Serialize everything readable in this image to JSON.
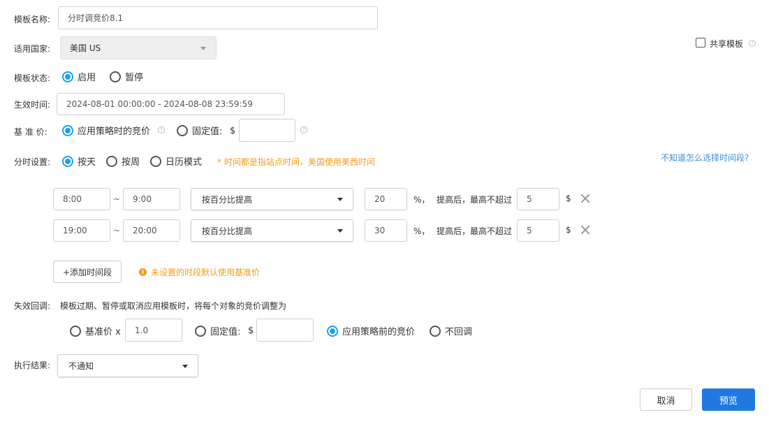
{
  "form": {
    "template_name": {
      "label": "模板名称:",
      "value": "分时调竞价8.1"
    },
    "country": {
      "label": "适用国家:",
      "value": "美国 US"
    },
    "share": {
      "label": "共享模板",
      "checked": false
    },
    "status": {
      "label": "模板状态:",
      "options": [
        {
          "label": "启用",
          "selected": true
        },
        {
          "label": "暂停",
          "selected": false
        }
      ]
    },
    "effective_time": {
      "label": "生效时间:",
      "value": "2024-08-01 00:00:00 - 2024-08-08 23:59:59"
    },
    "base_price": {
      "label": "基 准 价:",
      "options": [
        {
          "label": "应用策略时的竞价",
          "selected": true
        },
        {
          "label": "固定值:",
          "selected": false
        }
      ],
      "currency": "$",
      "fixed_value": ""
    },
    "time_setting": {
      "label": "分时设置:",
      "options": [
        {
          "label": "按天",
          "selected": true
        },
        {
          "label": "按周",
          "selected": false
        },
        {
          "label": "日历模式",
          "selected": false
        }
      ],
      "note": "* 时间都是指站点时间，美国使用美西时间",
      "help_link": "不知道怎么选择时间段?"
    },
    "periods": [
      {
        "start": "8:00",
        "end": "9:00",
        "mode": "按百分比提高",
        "percent": "20",
        "percent_suffix": "%，",
        "cap_label": "提高后，最高不超过",
        "cap": "5",
        "currency": "$"
      },
      {
        "start": "19:00",
        "end": "20:00",
        "mode": "按百分比提高",
        "percent": "30",
        "percent_suffix": "%，",
        "cap_label": "提高后，最高不超过",
        "cap": "5",
        "currency": "$"
      }
    ],
    "range_separator": "~",
    "add_period_label": "+添加时间段",
    "default_note": "未设置的时段默认使用基准价",
    "fallback": {
      "label": "失效回调:",
      "description": "模板过期、暂停或取消应用模板时，将每个对象的竞价调整为",
      "options": [
        {
          "label": "基准价 x",
          "selected": false
        },
        {
          "label": "固定值:",
          "selected": false
        },
        {
          "label": "应用策略前的竞价",
          "selected": true
        },
        {
          "label": "不回调",
          "selected": false
        }
      ],
      "multiplier": "1.0",
      "currency": "$",
      "fixed_value": ""
    },
    "result": {
      "label": "执行结果:",
      "value": "不通知"
    }
  },
  "buttons": {
    "cancel": "取消",
    "preview": "预览"
  },
  "colors": {
    "accent": "#1aa0f0",
    "primary": "#2079e0",
    "warning": "#f59a14",
    "link": "#3c8ed8"
  }
}
